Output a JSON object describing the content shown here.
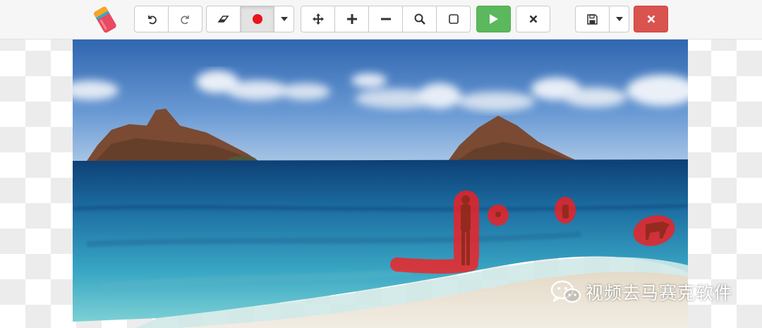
{
  "app": {
    "logo_icon": "eraser-logo-icon"
  },
  "toolbar": {
    "history": [
      {
        "icon": "undo-icon",
        "name": "undo-button"
      },
      {
        "icon": "redo-icon",
        "name": "redo-button"
      }
    ],
    "tools": [
      {
        "icon": "eraser-icon",
        "name": "eraser-tool-button",
        "active": false
      },
      {
        "icon": "brush-dot-icon",
        "name": "brush-tool-button",
        "active": true,
        "color": "#e8141b"
      },
      {
        "icon": "chevron-down-icon",
        "name": "brush-size-dropdown"
      }
    ],
    "view": [
      {
        "icon": "move-icon",
        "name": "pan-button"
      },
      {
        "icon": "plus-icon",
        "name": "zoom-in-button"
      },
      {
        "icon": "minus-icon",
        "name": "zoom-out-button"
      },
      {
        "icon": "search-icon",
        "name": "zoom-fit-button"
      },
      {
        "icon": "square-icon",
        "name": "original-size-button"
      }
    ],
    "run": {
      "icon": "play-icon",
      "name": "run-inpaint-button",
      "color": "#5cb85c"
    },
    "clear": {
      "icon": "close-icon",
      "name": "clear-mask-button"
    },
    "save": [
      {
        "icon": "floppy-disk-icon",
        "name": "save-button"
      },
      {
        "icon": "chevron-down-icon",
        "name": "save-options-dropdown"
      }
    ],
    "close": {
      "icon": "close-icon",
      "name": "close-image-button",
      "color": "#d9534f"
    }
  },
  "canvas": {
    "scene": "beach-photo",
    "mask_color": "#ff1a1a"
  },
  "watermark": {
    "icon": "wechat-icon",
    "text": "视频去马赛克软件"
  }
}
